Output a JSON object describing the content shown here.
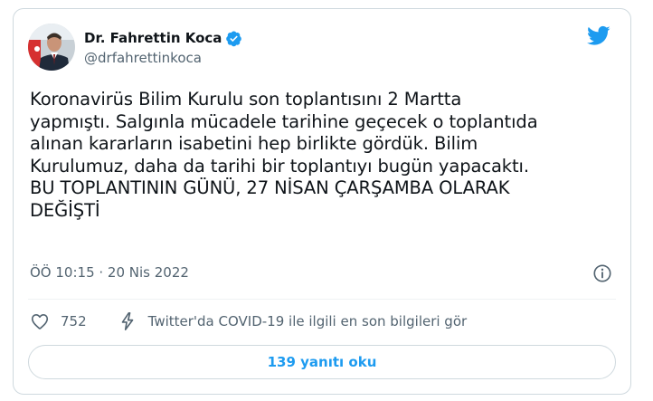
{
  "author": {
    "display_name": "Dr. Fahrettin Koca",
    "handle": "@drfahrettinkoca",
    "verified_icon": "verified-badge-icon"
  },
  "logo_icon": "twitter-bird-icon",
  "tweet": {
    "text": "Koronavirüs Bilim Kurulu son toplantısını 2 Martta\nyapmıştı. Salgınla mücadele tarihine geçecek o toplantıda\nalınan kararların isabetini hep birlikte gördük. Bilim\nKurulumuz, daha da tarihi bir toplantıyı bugün yapacaktı.\nBU TOPLANTININ GÜNÜ, 27 NİSAN ÇARŞAMBA OLARAK\nDEĞİŞTİ",
    "timestamp": "ÖÖ 10:15 · 20 Nis 2022"
  },
  "actions": {
    "like_icon": "heart-icon",
    "like_count": "752",
    "covid_icon": "lightning-icon",
    "covid_text": "Twitter'da COVID-19 ile ilgili en son bilgileri gör",
    "info_icon": "info-icon"
  },
  "replies_button": {
    "label": "139 yanıtı oku"
  },
  "colors": {
    "accent": "#1d9bf0",
    "text": "#0f1419",
    "secondary": "#536471",
    "border": "#cfd9de"
  }
}
